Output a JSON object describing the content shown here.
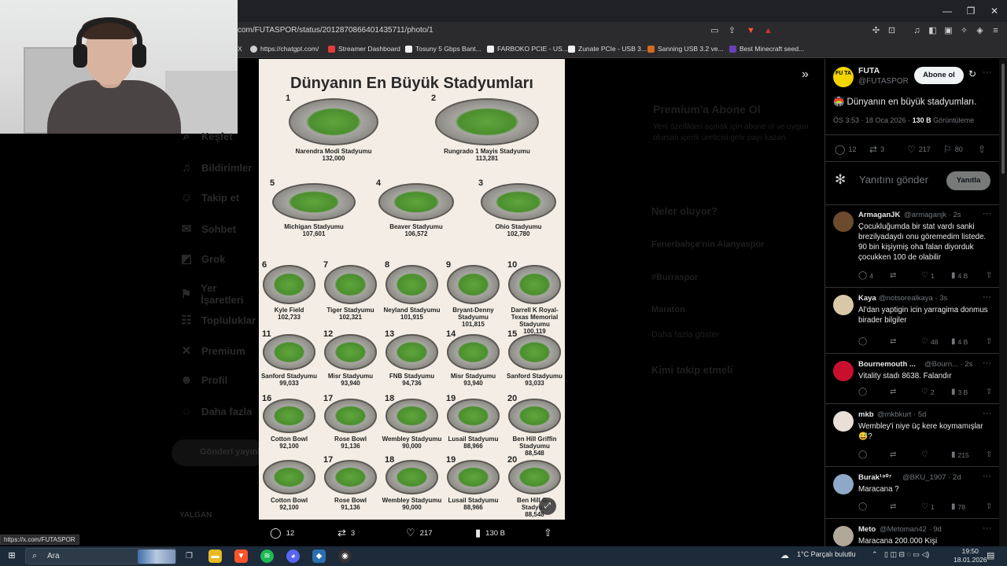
{
  "browser": {
    "url": "com/FUTASPOR/status/2012870866401435711/photo/1",
    "bookmarks": [
      {
        "label": "X",
        "color": "#000000"
      },
      {
        "label": "https://chatgpt.com/",
        "color": "#cfcfcf"
      },
      {
        "label": "Streamer Dashboard",
        "color": "#e23c3c"
      },
      {
        "label": "Tosuny 5 Gbps Bant...",
        "color": "#f0f0f0"
      },
      {
        "label": "FARBOKO PCIE - US...",
        "color": "#f0f0f0"
      },
      {
        "label": "Zunate PCIe - USB 3...",
        "color": "#f0f0f0"
      },
      {
        "label": "Sanning USB 3.2 ve...",
        "color": "#d46a1e"
      },
      {
        "label": "Best Minecraft seed...",
        "color": "#6a3fb8"
      }
    ],
    "status_url": "https://x.com/FUTASPOR"
  },
  "left_nav": {
    "items": [
      "Keşfet",
      "Bildirimler",
      "Takip et",
      "Sohbet",
      "Grok",
      "Yer İşaretleri",
      "Topluluklar",
      "Premium",
      "Profil",
      "Daha fazla"
    ],
    "post_button": "Gönderi yayınla",
    "user_label": "YALGAN"
  },
  "dim_right": {
    "premium_title": "Premium'a Abone Ol",
    "premium_body": "Yeni özellikleri açmak için abone ol ve uygun olursan içerik üreticisi gelir payı kazan.",
    "happening_title": "Neler oluyor?",
    "trend1": "Fenerbahçe'nin Alanyaspor",
    "trend2": "#Burraspor",
    "trend3": "Maraton",
    "show_more": "Daha fazla göster",
    "follow_title": "Kimi takip etmeli"
  },
  "image": {
    "title": "Dünyanın En Büyük Stadyumları",
    "stadiums": [
      {
        "rank": "1",
        "name": "Narendra Modi Stadyumu",
        "cap": "132,000"
      },
      {
        "rank": "2",
        "name": "Rungrado 1 Mayis Stadyumu",
        "cap": "113,281"
      },
      {
        "rank": "5",
        "name": "Michigan Stadyumu",
        "cap": "107,601"
      },
      {
        "rank": "4",
        "name": "Beaver Stadyumu",
        "cap": "106,572"
      },
      {
        "rank": "3",
        "name": "Ohio Stadyumu",
        "cap": "102,780"
      },
      {
        "rank": "6",
        "name": "Kyle Field",
        "cap": "102,733"
      },
      {
        "rank": "7",
        "name": "Tiger Stadyumu",
        "cap": "102,321"
      },
      {
        "rank": "8",
        "name": "Neyland Stadyumu",
        "cap": "101,915"
      },
      {
        "rank": "9",
        "name": "Bryant-Denny Stadyumu",
        "cap": "101,815"
      },
      {
        "rank": "10",
        "name": "Darrell K Royal-Texas Memorial Stadyumu",
        "cap": "100,119"
      },
      {
        "rank": "11",
        "name": "Sanford Stadyumu",
        "cap": "99,033"
      },
      {
        "rank": "12",
        "name": "Misr Stadyumu",
        "cap": "93,940"
      },
      {
        "rank": "13",
        "name": "FNB Stadyumu",
        "cap": "94,736"
      },
      {
        "rank": "14",
        "name": "Misr Stadyumu",
        "cap": "93,940"
      },
      {
        "rank": "15",
        "name": "Sanford Stadyumu",
        "cap": "93,033"
      },
      {
        "rank": "16",
        "name": "Cotton Bowl",
        "cap": "92,100"
      },
      {
        "rank": "17",
        "name": "Rose Bowl",
        "cap": "91,136"
      },
      {
        "rank": "18",
        "name": "Wembley Stadyumu",
        "cap": "90,000"
      },
      {
        "rank": "19",
        "name": "Lusail Stadyumu",
        "cap": "88,966"
      },
      {
        "rank": "20",
        "name": "Ben Hill Griffin Stadyumu",
        "cap": "88,548"
      },
      {
        "rank": "",
        "name": "Cotton Bowl",
        "cap": "92,100"
      },
      {
        "rank": "17",
        "name": "Rose Bowl",
        "cap": "91,136"
      },
      {
        "rank": "18",
        "name": "Wembley Stadyumu",
        "cap": "90,000"
      },
      {
        "rank": "19",
        "name": "Lusail Stadyumu",
        "cap": "88,966"
      },
      {
        "rank": "20",
        "name": "Ben Hill G... Stadyu...",
        "cap": "88,548"
      }
    ]
  },
  "action_bar": {
    "replies": "12",
    "reposts": "3",
    "likes": "217",
    "views": "130 B"
  },
  "tweet": {
    "author": "FUTA",
    "handle": "@FUTASPOR",
    "avatar_text": "FU TA",
    "follow_label": "Abone ol",
    "text": "🏟️ Dünyanın en büyük stadyumları.",
    "time": "ÖS 3:53 · 18 Oca 2026 ·",
    "views_count": "130 B",
    "views_label": "Görüntüleme",
    "stats": {
      "replies": "12",
      "reposts": "3",
      "likes": "217",
      "bookmarks": "80"
    },
    "reply_placeholder": "Yanıtını gönder",
    "reply_button": "Yanıtla"
  },
  "replies": [
    {
      "name": "ArmaganJK",
      "handle": "@armaganjk · 2s",
      "text": "Çocukluğumda bir stat vardı sanki brezilyadaydı onu göremedim listede. 90 bin kişiymiş oha falan diyorduk çocukken 100 de olabilir",
      "r": "4",
      "rt": "",
      "l": "1",
      "v": "4 B",
      "color": "#6b4a2e"
    },
    {
      "name": "Kaya",
      "handle": "@notsorealkaya · 3s",
      "text": "Al'dan yaptigin icin yarragima donmus birader bilgiler",
      "r": "",
      "rt": "",
      "l": "48",
      "v": "4 B",
      "color": "#d8c8a8"
    },
    {
      "name": "Bournemouth ...",
      "handle": "@Bourn... · 2s",
      "text": "Vitality stadı 8638. Falandır",
      "r": "",
      "rt": "",
      "l": "2",
      "v": "3 B",
      "color": "#c8102e"
    },
    {
      "name": "mkb",
      "handle": "@mkbkurt · 5d",
      "text": "Wembley'i niye üç kere koymamışlar 😅?",
      "r": "",
      "rt": "",
      "l": "",
      "v": "215",
      "color": "#e8e0d8"
    },
    {
      "name": "Burak¹⁹⁰⁷",
      "handle": "@BKU_1907 · 2d",
      "text": "Maracana ?",
      "r": "",
      "rt": "",
      "l": "1",
      "v": "78",
      "color": "#8fa8c8"
    },
    {
      "name": "Meto",
      "handle": "@Metoman42 · 9d",
      "text": "Maracana 200.000 Kişi",
      "r": "",
      "rt": "",
      "l": "",
      "v": "",
      "color": "#b0a898"
    }
  ],
  "taskbar": {
    "search_label": "Ara",
    "weather": "1°C  Parçalı bulutlu",
    "time": "19:50",
    "date": "18.01.2026"
  }
}
